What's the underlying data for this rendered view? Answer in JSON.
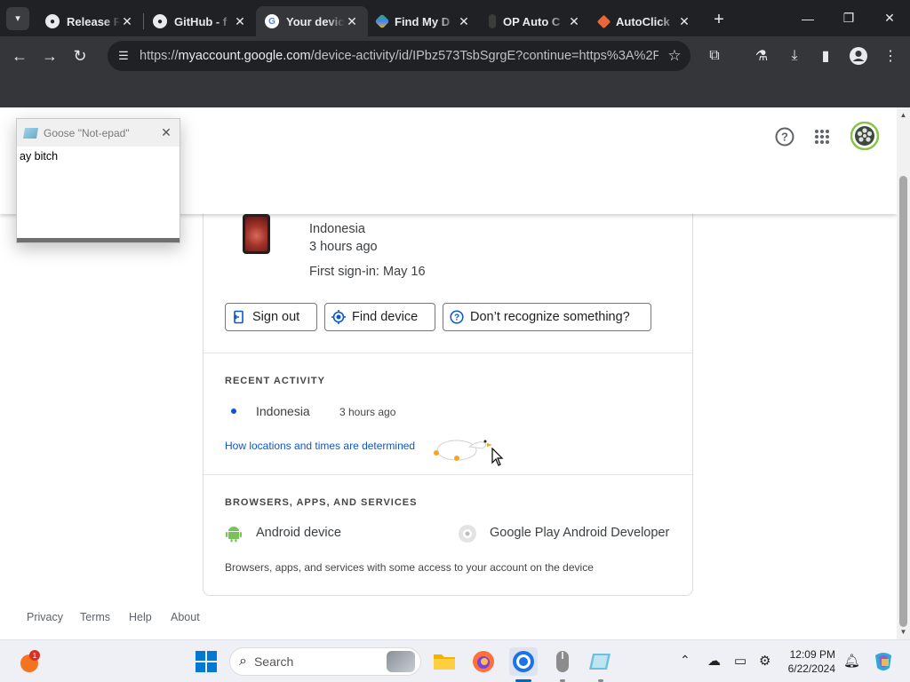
{
  "browser": {
    "tabs": [
      {
        "title": "Release Re",
        "icon": "github-icon",
        "active": false
      },
      {
        "title": "GitHub - f",
        "icon": "github-icon",
        "active": false
      },
      {
        "title": "Your devic",
        "icon": "google-icon",
        "active": true
      },
      {
        "title": "Find My D",
        "icon": "find-my-device-icon",
        "active": false
      },
      {
        "title": "OP Auto C",
        "icon": "op-auto-clicker-icon",
        "active": false
      },
      {
        "title": "AutoClick",
        "icon": "autoclicker-icon",
        "active": false
      }
    ],
    "url_prefix": "https://",
    "url_host": "myaccount.google.com",
    "url_rest": "/device-activity/id/IPbz573TsbSgrgE?continue=https%3A%2F..."
  },
  "notepad": {
    "title": "Goose \"Not-epad\"",
    "content": "ay bitch"
  },
  "device": {
    "location": "Indonesia",
    "time": "3 hours ago",
    "first_signin": "First sign-in: May 16"
  },
  "actions": {
    "sign_out": "Sign out",
    "find_device": "Find device",
    "dont_recognize": "Don’t recognize something?"
  },
  "recent_activity": {
    "heading": "RECENT ACTIVITY",
    "location": "Indonesia",
    "time": "3 hours ago",
    "link": "How locations and times are determined"
  },
  "services": {
    "heading": "BROWSERS, APPS, AND SERVICES",
    "items": [
      "Android device",
      "Google Play Android Developer"
    ],
    "note": "Browsers, apps, and services with some access to your account on the device"
  },
  "footer": [
    "Privacy",
    "Terms",
    "Help",
    "About"
  ],
  "taskbar": {
    "search_placeholder": "Search",
    "time": "12:09 PM",
    "date": "6/22/2024",
    "notification_count": "1"
  },
  "colors": {
    "accent": "#0b57d0",
    "chrome_dark": "#202124",
    "android_green": "#78c257"
  }
}
